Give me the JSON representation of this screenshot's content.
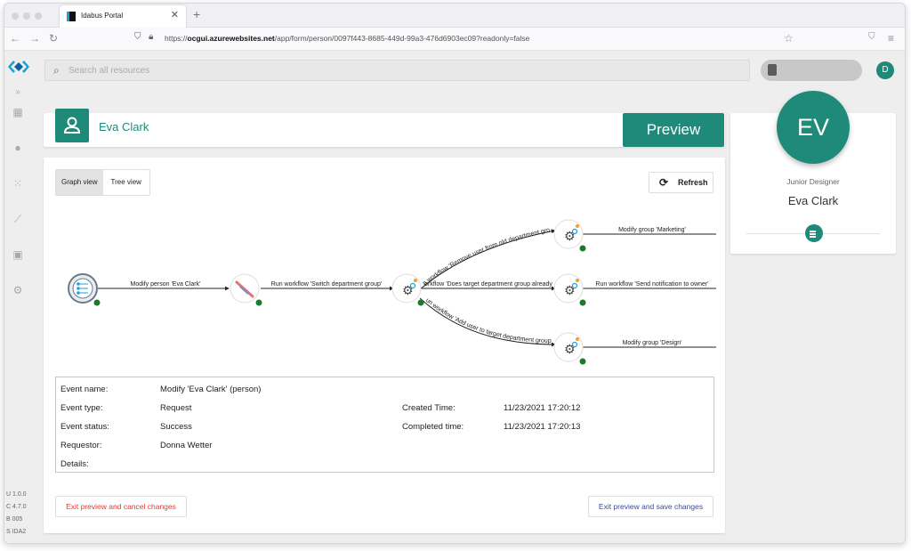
{
  "browser": {
    "tab_title": "Idabus Portal",
    "url_prefix": "https://",
    "url_host": "ocgui.azurewebsites.net",
    "url_path": "/app/form/person/0097f443-8685-449d-99a3-476d6903ec09?readonly=false"
  },
  "search": {
    "placeholder": "Search all resources"
  },
  "user_initial": "D",
  "header": {
    "title": "Eva Clark",
    "preview_label": "Preview"
  },
  "view_toggle": {
    "graph": "Graph view",
    "tree": "Tree view"
  },
  "refresh_label": "Refresh",
  "graph": {
    "edges": [
      "Modify person 'Eva Clark'",
      "Run workflow 'Switch department group'",
      "n workflow 'Remove user from old department gro",
      "orkflow 'Does target department group already",
      "un workflow 'Add user to target department group",
      "Modify group 'Marketing'",
      "Run workflow 'Send notification to owner'",
      "Modify group 'Design'"
    ]
  },
  "details": {
    "event_name_label": "Event name:",
    "event_name": "Modify 'Eva Clark' (person)",
    "event_type_label": "Event type:",
    "event_type": "Request",
    "event_status_label": "Event status:",
    "event_status": "Success",
    "requestor_label": "Requestor:",
    "requestor": "Donna Wetter",
    "details_label": "Details:",
    "created_label": "Created Time:",
    "created": "11/23/2021 17:20:12",
    "completed_label": "Completed time:",
    "completed": "11/23/2021 17:20:13"
  },
  "actions": {
    "cancel": "Exit preview and cancel changes",
    "save": "Exit preview and save changes"
  },
  "profile": {
    "initials": "EV",
    "job_title": "Junior Designer",
    "name": "Eva Clark"
  },
  "version": [
    "U 1.0.0",
    "C 4.7.0",
    "B 005",
    "S IDA2"
  ],
  "colors": {
    "accent": "#1f8a79",
    "danger": "#e53935",
    "primary": "#3949ab",
    "status_ok": "#2e7d32"
  }
}
